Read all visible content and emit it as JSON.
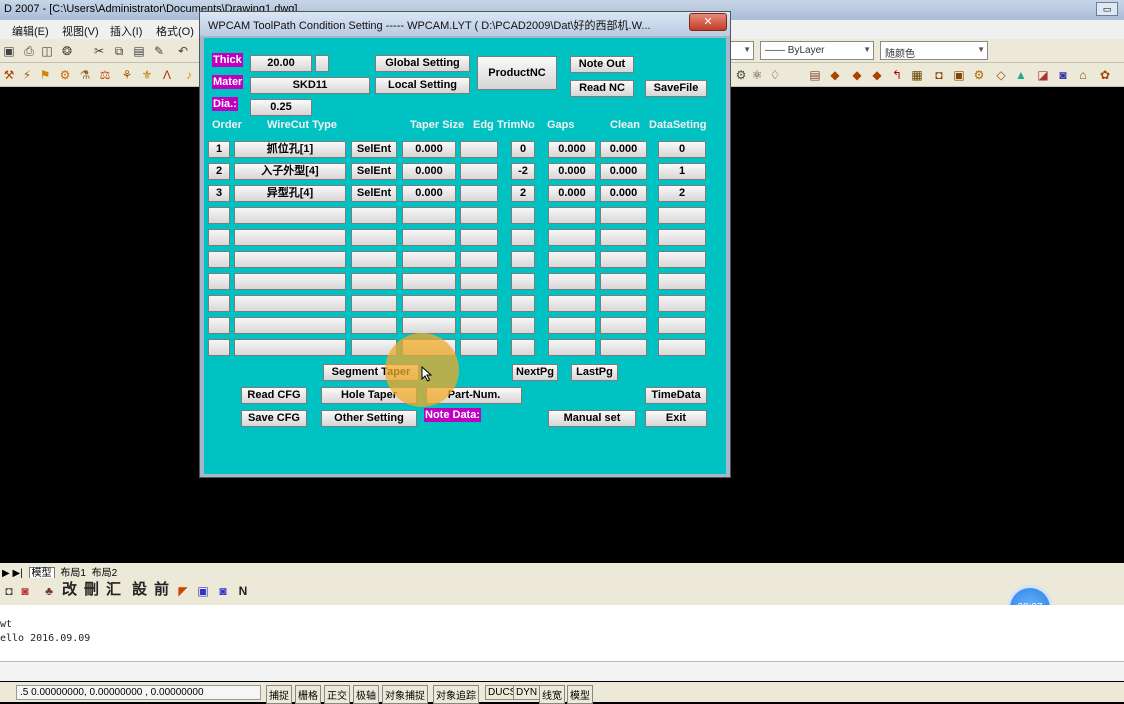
{
  "app": {
    "title": "D 2007 - [C:\\Users\\Administrator\\Documents\\Drawing1.dwg]",
    "menu": [
      "编辑(E)",
      "视图(V)",
      "插入(I)",
      "格式(O)"
    ],
    "linetype_combo": "—— ByLayer",
    "color_combo": "随颜色",
    "layout_tabs": [
      "模型",
      "布局1",
      "布局2"
    ],
    "toolbar3_labels": [
      "改",
      "刪",
      "汇",
      "設",
      "前"
    ],
    "command_lines": [
      "wt",
      "ello 2016.09.09"
    ],
    "coords": ".5  0.00000000,    0.00000000  ,  0.00000000",
    "status_buttons": [
      "捕捉",
      "栅格",
      "正交",
      "极轴",
      "对象捕捉",
      "对象追踪",
      "DUCS",
      "DYN",
      "线宽",
      "模型"
    ],
    "timer_badge": "00:07"
  },
  "dialog": {
    "title": "WPCAM ToolPath Condition Setting ----- WPCAM.LYT ( D:\\PCAD2009\\Dat\\好的西部机.W...",
    "thick_label": "Thick",
    "thick_value": "20.00",
    "mater_label": "Mater",
    "mater_value": "SKD11",
    "dia_label": "Dia.:",
    "dia_value": "0.25",
    "buttons": {
      "global_setting": "Global Setting",
      "local_setting": "Local Setting",
      "product_nc": "ProductNC",
      "note_out": "Note Out",
      "read_nc": "Read NC",
      "save_file": "SaveFile",
      "segment_taper": "Segment Taper",
      "next_pg": "NextPg",
      "last_pg": "LastPg",
      "read_cfg": "Read CFG",
      "hole_taper": "Hole Taper",
      "part_num": "Part-Num.",
      "time_data": "TimeData",
      "save_cfg": "Save CFG",
      "other_setting": "Other Setting",
      "manual_set": "Manual  set",
      "exit": "Exit"
    },
    "note_data_label": "Note Data:",
    "headers": {
      "order": "Order",
      "wirecut_type": "WireCut Type",
      "taper_size": "Taper Size",
      "edg": "Edg",
      "trim_no": "TrimNo",
      "gaps": "Gaps",
      "clean": "Clean",
      "data_seting": "DataSeting"
    },
    "rows": [
      {
        "order": "1",
        "type": "抓位孔[1]",
        "sel": "SelEnt",
        "taper": "0.000",
        "edg": "",
        "trim": "0",
        "gaps": "0.000",
        "clean": "0.000",
        "data": "0"
      },
      {
        "order": "2",
        "type": "入子外型[4]",
        "sel": "SelEnt",
        "taper": "0.000",
        "edg": "",
        "trim": "-2",
        "gaps": "0.000",
        "clean": "0.000",
        "data": "1"
      },
      {
        "order": "3",
        "type": "异型孔[4]",
        "sel": "SelEnt",
        "taper": "0.000",
        "edg": "",
        "trim": "2",
        "gaps": "0.000",
        "clean": "0.000",
        "data": "2"
      },
      {
        "order": "",
        "type": "",
        "sel": "",
        "taper": "",
        "edg": "",
        "trim": "",
        "gaps": "",
        "clean": "",
        "data": ""
      },
      {
        "order": "",
        "type": "",
        "sel": "",
        "taper": "",
        "edg": "",
        "trim": "",
        "gaps": "",
        "clean": "",
        "data": ""
      },
      {
        "order": "",
        "type": "",
        "sel": "",
        "taper": "",
        "edg": "",
        "trim": "",
        "gaps": "",
        "clean": "",
        "data": ""
      },
      {
        "order": "",
        "type": "",
        "sel": "",
        "taper": "",
        "edg": "",
        "trim": "",
        "gaps": "",
        "clean": "",
        "data": ""
      },
      {
        "order": "",
        "type": "",
        "sel": "",
        "taper": "",
        "edg": "",
        "trim": "",
        "gaps": "",
        "clean": "",
        "data": ""
      },
      {
        "order": "",
        "type": "",
        "sel": "",
        "taper": "",
        "edg": "",
        "trim": "",
        "gaps": "",
        "clean": "",
        "data": ""
      },
      {
        "order": "",
        "type": "",
        "sel": "",
        "taper": "",
        "edg": "",
        "trim": "",
        "gaps": "",
        "clean": "",
        "data": ""
      }
    ]
  }
}
